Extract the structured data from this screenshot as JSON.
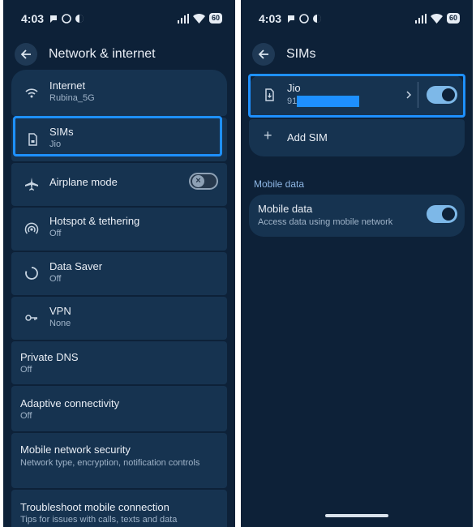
{
  "status": {
    "time": "4:03",
    "battery": "60"
  },
  "left": {
    "title": "Network & internet",
    "rows": [
      {
        "title": "Internet",
        "sub": "Rubina_5G"
      },
      {
        "title": "SIMs",
        "sub": "Jio"
      },
      {
        "title": "Airplane mode",
        "sub": ""
      },
      {
        "title": "Hotspot & tethering",
        "sub": "Off"
      },
      {
        "title": "Data Saver",
        "sub": "Off"
      },
      {
        "title": "VPN",
        "sub": "None"
      },
      {
        "title": "Private DNS",
        "sub": "Off"
      },
      {
        "title": "Adaptive connectivity",
        "sub": "Off"
      },
      {
        "title": "Mobile network security",
        "sub": "Network type, encryption, notification controls"
      },
      {
        "title": "Troubleshoot mobile connection",
        "sub": "Tips for issues with calls, texts and data"
      }
    ],
    "airplane_mode_on": false
  },
  "right": {
    "title": "SIMs",
    "sim": {
      "name": "Jio",
      "number_prefix": "91",
      "enabled": true
    },
    "add_sim": "Add SIM",
    "section": "Mobile data",
    "mobile_data": {
      "title": "Mobile data",
      "sub": "Access data using mobile network",
      "enabled": true
    }
  },
  "colors": {
    "background": "#0d2138",
    "card": "#163350",
    "highlight": "#1e90ff",
    "toggle_on": "#7db8e8"
  }
}
